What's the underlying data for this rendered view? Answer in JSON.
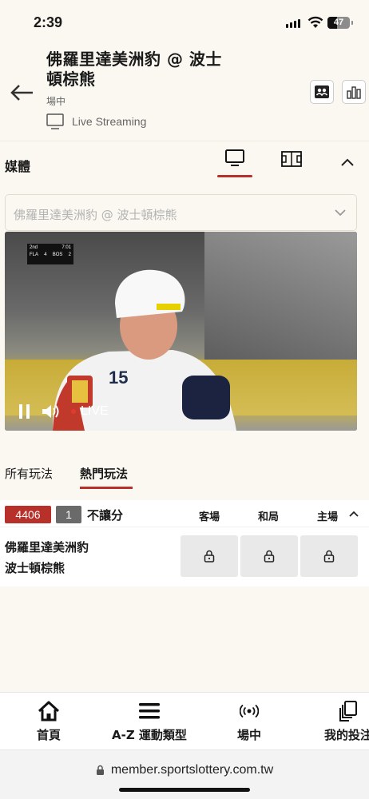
{
  "status_bar": {
    "time": "2:39",
    "battery": "47"
  },
  "header": {
    "title": "佛羅里達美洲豹 @ 波士頓棕熊",
    "status": "場中",
    "streaming_label": "Live Streaming"
  },
  "media": {
    "label": "媒體"
  },
  "stream_select": {
    "value": "佛羅里達美洲豹 @ 波士頓棕熊"
  },
  "video": {
    "scoreboard": {
      "period": "2nd",
      "clock": "7:01",
      "away": "FLA",
      "away_score": "4",
      "home": "BOS",
      "home_score": "2"
    },
    "live_label": "LIVE"
  },
  "tabs": [
    {
      "label": "所有玩法",
      "active": false
    },
    {
      "label": "熱門玩法",
      "active": true
    }
  ],
  "market": {
    "code": "4406",
    "number": "1",
    "name": "不讓分",
    "columns": [
      "客場",
      "和局",
      "主場"
    ],
    "teams": [
      "佛羅里達美洲豹",
      "波士頓棕熊"
    ]
  },
  "bottom_nav": [
    {
      "label": "首頁",
      "icon": "home-icon"
    },
    {
      "label": "A-Z 運動類型",
      "icon": "menu-icon"
    },
    {
      "label": "場中",
      "icon": "live-broadcast-icon"
    },
    {
      "label": "我的投注",
      "icon": "bets-icon"
    }
  ],
  "browser": {
    "url": "member.sportslottery.com.tw"
  },
  "colors": {
    "accent": "#b8302a",
    "background": "#fbf8f1",
    "number_badge": "#6a6a6a"
  }
}
